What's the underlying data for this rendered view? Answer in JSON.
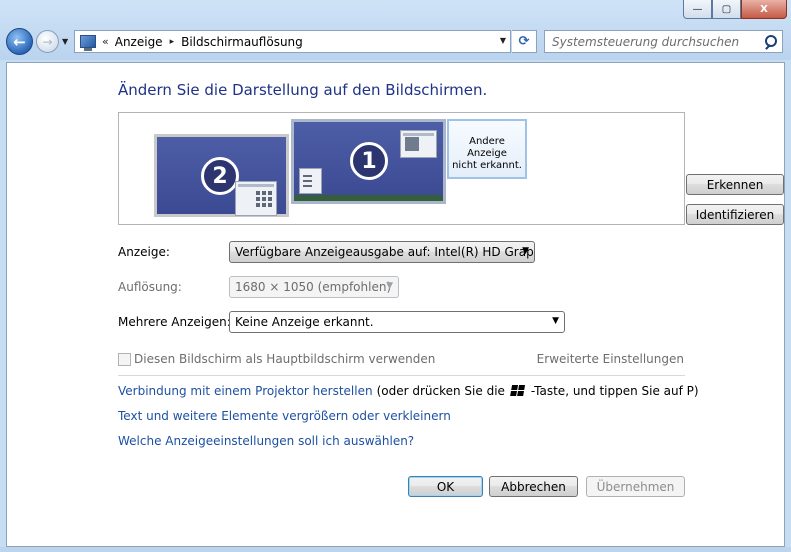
{
  "window": {
    "minimize_glyph": "—",
    "maximize_glyph": "▢",
    "close_glyph": "X"
  },
  "nav": {
    "back_glyph": "←",
    "forward_glyph": "→"
  },
  "address": {
    "prefix": "«",
    "crumb1": "Anzeige",
    "crumb2": "Bildschirmauflösung",
    "separator": "▸"
  },
  "search": {
    "placeholder": "Systemsteuerung durchsuchen"
  },
  "page": {
    "heading": "Ändern Sie die Darstellung auf den Bildschirmen."
  },
  "monitors": {
    "monitor2_label": "2",
    "monitor1_label": "1",
    "unknown_line1": "Andere Anzeige",
    "unknown_line2": "nicht erkannt."
  },
  "buttons": {
    "detect": "Erkennen",
    "identify": "Identifizieren",
    "ok": "OK",
    "cancel": "Abbrechen",
    "apply": "Übernehmen"
  },
  "form": {
    "display_label": "Anzeige:",
    "display_value": "Verfügbare Anzeigeausgabe auf: Intel(R) HD Graphics",
    "resolution_label": "Auflösung:",
    "resolution_value": "1680 × 1050 (empfohlen)",
    "multi_label": "Mehrere Anzeigen:",
    "multi_value": "Keine Anzeige erkannt."
  },
  "options": {
    "primary_checkbox": "Diesen Bildschirm als Hauptbildschirm verwenden",
    "advanced": "Erweiterte Einstellungen"
  },
  "links": {
    "projector": "Verbindung mit einem Projektor herstellen",
    "projector_hint_pre": "(oder drücken Sie die",
    "projector_hint_post": "-Taste, und tippen Sie auf P)",
    "text_size": "Text und weitere Elemente vergrößern oder verkleinern",
    "which_settings": "Welche Anzeigeeinstellungen soll ich auswählen?"
  },
  "icons": {
    "back": "back-arrow-icon",
    "forward": "forward-arrow-icon",
    "refresh": "refresh-icon",
    "search": "search-icon",
    "control_panel": "display-control-panel-icon",
    "windows_key": "windows-logo-icon"
  },
  "colors": {
    "heading": "#1e3287",
    "link": "#1e50a2",
    "monitor_bg": "#3b4a92",
    "frame": "#c7ddf2"
  }
}
